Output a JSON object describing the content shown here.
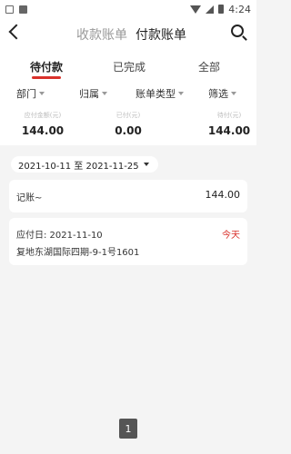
{
  "status_bar": {
    "time": "4:24",
    "icon_a": "A"
  },
  "header": {
    "tab_receivable": "收款账单",
    "tab_payable": "付款账单"
  },
  "sub_tabs": [
    {
      "label": "待付款"
    },
    {
      "label": "已完成"
    },
    {
      "label": "全部"
    }
  ],
  "filters": [
    {
      "label": "部门"
    },
    {
      "label": "归属"
    },
    {
      "label": "账单类型"
    },
    {
      "label": "筛选"
    }
  ],
  "summary": [
    {
      "label": "应付金额(元)",
      "value": "144.00"
    },
    {
      "label": "已付(元)",
      "value": "0.00"
    },
    {
      "label": "待付(元)",
      "value": "144.00"
    }
  ],
  "date_range": "2021-10-11 至 2021-11-25",
  "records": [
    {
      "title": "记账~",
      "amount": "144.00",
      "due_label": "应付日: 2021-11-10",
      "due_tag": "今天",
      "address": "复地东湖国际四期-9-1号1601"
    }
  ],
  "pagination": {
    "current": "1"
  },
  "colors": {
    "accent": "#d9312b",
    "background": "#f4f4f4"
  }
}
